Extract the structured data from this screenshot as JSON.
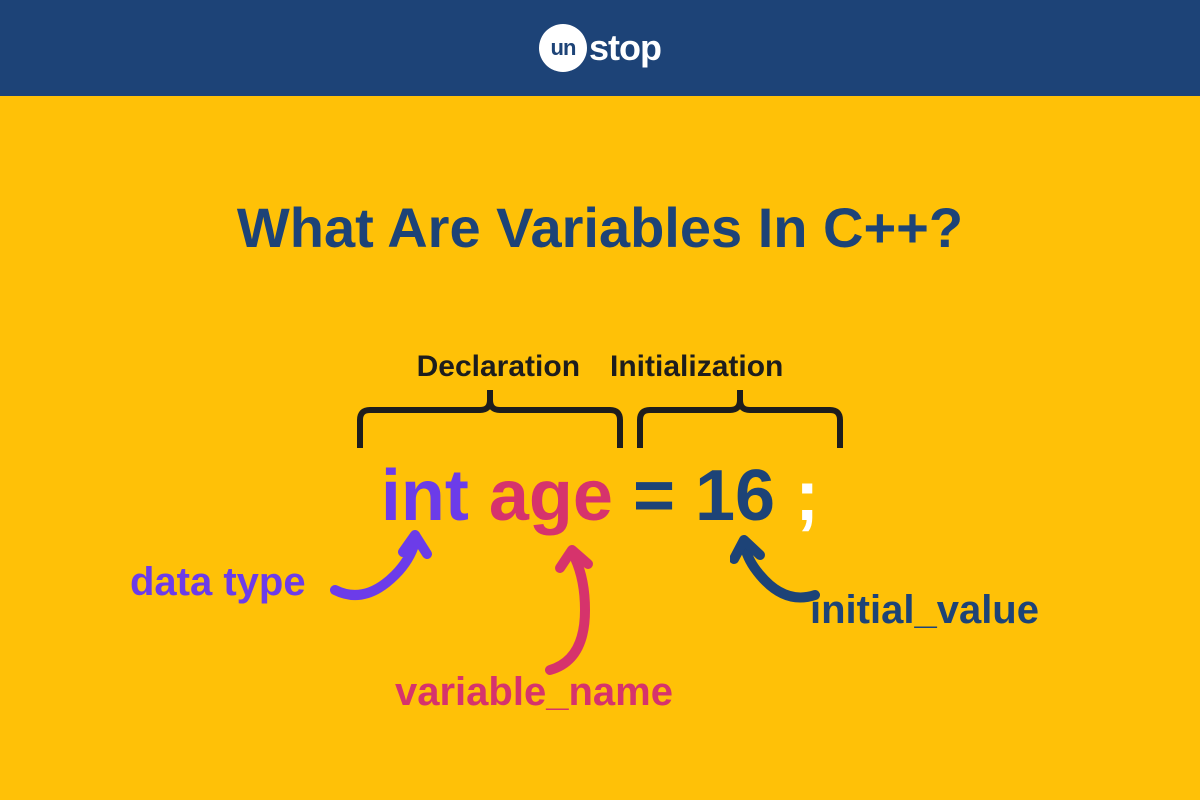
{
  "brand": {
    "circle": "un",
    "rest": "stop"
  },
  "title": "What Are Variables In C++?",
  "topLabels": {
    "declaration": "Declaration",
    "initialization": "Initialization"
  },
  "code": {
    "int": "int",
    "age": "age",
    "eq": "=",
    "val": "16",
    "semi": ";"
  },
  "callouts": {
    "dataType": "data type",
    "variableName": "variable_name",
    "initialValue": "initial_value"
  },
  "colors": {
    "bg": "#ffc107",
    "header": "#1d4377",
    "purple": "#6c3ce9",
    "pink": "#d6336c",
    "navy": "#1d4377",
    "white": "#ffffff",
    "dark": "#1d1d1d"
  }
}
